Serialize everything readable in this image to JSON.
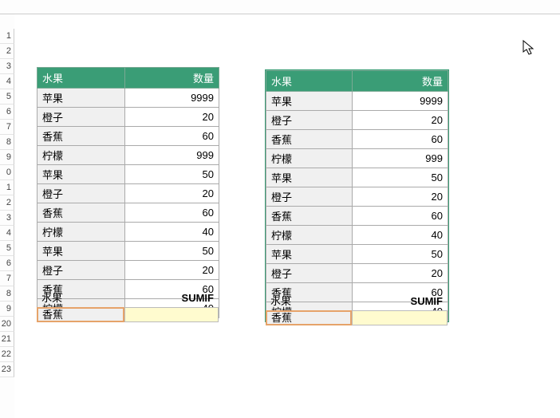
{
  "row_headers": [
    "1",
    "2",
    "3",
    "4",
    "5",
    "6",
    "7",
    "8",
    "9",
    "0",
    "1",
    "2",
    "3",
    "4",
    "5",
    "6",
    "7",
    "8",
    "9",
    "20",
    "21",
    "22",
    "23"
  ],
  "table_left": {
    "headers": [
      "水果",
      "数量"
    ],
    "rows": [
      [
        "苹果",
        "9999"
      ],
      [
        "橙子",
        "20"
      ],
      [
        "香蕉",
        "60"
      ],
      [
        "柠檬",
        "999"
      ],
      [
        "苹果",
        "50"
      ],
      [
        "橙子",
        "20"
      ],
      [
        "香蕉",
        "60"
      ],
      [
        "柠檬",
        "40"
      ],
      [
        "苹果",
        "50"
      ],
      [
        "橙子",
        "20"
      ],
      [
        "香蕉",
        "60"
      ],
      [
        "柠檬",
        "40"
      ]
    ],
    "footer_label_fruit": "水果",
    "footer_label_sumif": "SUMIF",
    "footer_value": "香蕉"
  },
  "table_right": {
    "headers": [
      "水果",
      "数量"
    ],
    "rows": [
      [
        "苹果",
        "9999"
      ],
      [
        "橙子",
        "20"
      ],
      [
        "香蕉",
        "60"
      ],
      [
        "柠檬",
        "999"
      ],
      [
        "苹果",
        "50"
      ],
      [
        "橙子",
        "20"
      ],
      [
        "香蕉",
        "60"
      ],
      [
        "柠檬",
        "40"
      ],
      [
        "苹果",
        "50"
      ],
      [
        "橙子",
        "20"
      ],
      [
        "香蕉",
        "60"
      ],
      [
        "柠檬",
        "40"
      ]
    ],
    "footer_label_fruit": "水果",
    "footer_label_sumif": "SUMIF",
    "footer_value": "香蕉"
  },
  "chart_data": {
    "type": "table",
    "tables": [
      {
        "title": "left",
        "columns": [
          "水果",
          "数量"
        ],
        "rows": [
          [
            "苹果",
            9999
          ],
          [
            "橙子",
            20
          ],
          [
            "香蕉",
            60
          ],
          [
            "柠檬",
            999
          ],
          [
            "苹果",
            50
          ],
          [
            "橙子",
            20
          ],
          [
            "香蕉",
            60
          ],
          [
            "柠檬",
            40
          ],
          [
            "苹果",
            50
          ],
          [
            "橙子",
            20
          ],
          [
            "香蕉",
            60
          ],
          [
            "柠檬",
            40
          ]
        ],
        "sumif_criteria": "香蕉"
      },
      {
        "title": "right",
        "columns": [
          "水果",
          "数量"
        ],
        "rows": [
          [
            "苹果",
            9999
          ],
          [
            "橙子",
            20
          ],
          [
            "香蕉",
            60
          ],
          [
            "柠檬",
            999
          ],
          [
            "苹果",
            50
          ],
          [
            "橙子",
            20
          ],
          [
            "香蕉",
            60
          ],
          [
            "柠檬",
            40
          ],
          [
            "苹果",
            50
          ],
          [
            "橙子",
            20
          ],
          [
            "香蕉",
            60
          ],
          [
            "柠檬",
            40
          ]
        ],
        "sumif_criteria": "香蕉"
      }
    ]
  }
}
